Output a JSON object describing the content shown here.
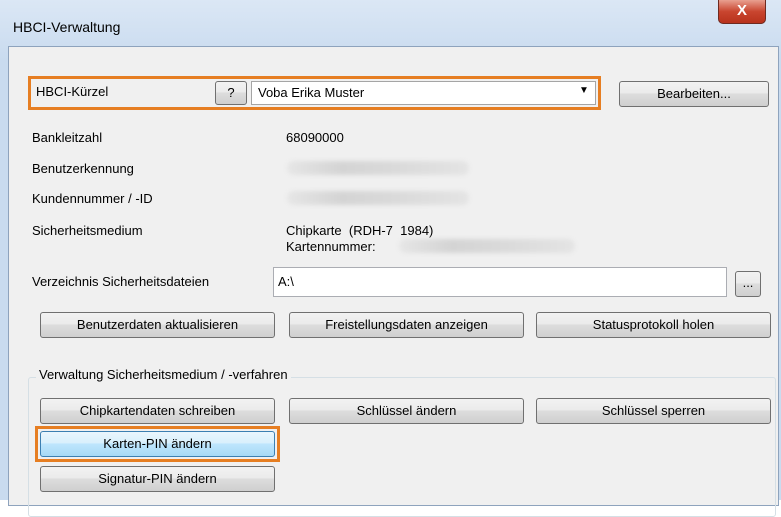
{
  "window": {
    "title": "HBCI-Verwaltung",
    "close_label": "X"
  },
  "top": {
    "kuerzel_label": "HBCI-Kürzel",
    "help_label": "?",
    "profile_value": "Voba Erika Muster",
    "edit_button": "Bearbeiten..."
  },
  "info": {
    "blz_label": "Bankleitzahl",
    "blz_value": "68090000",
    "user_label": "Benutzerkennung",
    "customer_label": "Kundennummer / -ID",
    "medium_label": "Sicherheitsmedium",
    "medium_value": "Chipkarte  (RDH-7  1984)",
    "card_label": "Kartennummer:"
  },
  "dir": {
    "label": "Verzeichnis Sicherheitsdateien",
    "value": "A:\\",
    "browse": "..."
  },
  "actions": {
    "update": "Benutzerdaten aktualisieren",
    "release": "Freistellungsdaten anzeigen",
    "status": "Statusprotokoll holen"
  },
  "group": {
    "title": "Verwaltung Sicherheitsmedium / -verfahren",
    "write_card": "Chipkartendaten schreiben",
    "change_key": "Schlüssel ändern",
    "block_key": "Schlüssel sperren",
    "change_pin": "Karten-PIN ändern",
    "change_sig_pin": "Signatur-PIN ändern"
  },
  "colors": {
    "highlight": "#e67e22",
    "close": "#c9452f"
  }
}
